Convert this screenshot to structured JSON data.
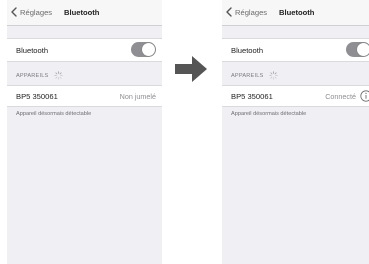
{
  "left_screen": {
    "back_label": "Réglages",
    "title": "Bluetooth",
    "bluetooth_label": "Bluetooth",
    "section_header": "APPAREILS",
    "device_name": "BP5 350061",
    "device_status": "Non jumelé",
    "footnote": "Appareil désormais détectable"
  },
  "right_screen": {
    "back_label": "Réglages",
    "title": "Bluetooth",
    "bluetooth_label": "Bluetooth",
    "section_header": "APPAREILS",
    "device_name": "BP5 350061",
    "device_status": "Connecté",
    "footnote": "Appareil désormais détectable"
  },
  "colors": {
    "screen_background": "#efeff4",
    "toggle_on": "#8e8e93",
    "arrow": "#555555"
  },
  "icons": [
    "chevron-left-icon",
    "spinner-icon",
    "info-icon",
    "arrow-right-icon"
  ]
}
